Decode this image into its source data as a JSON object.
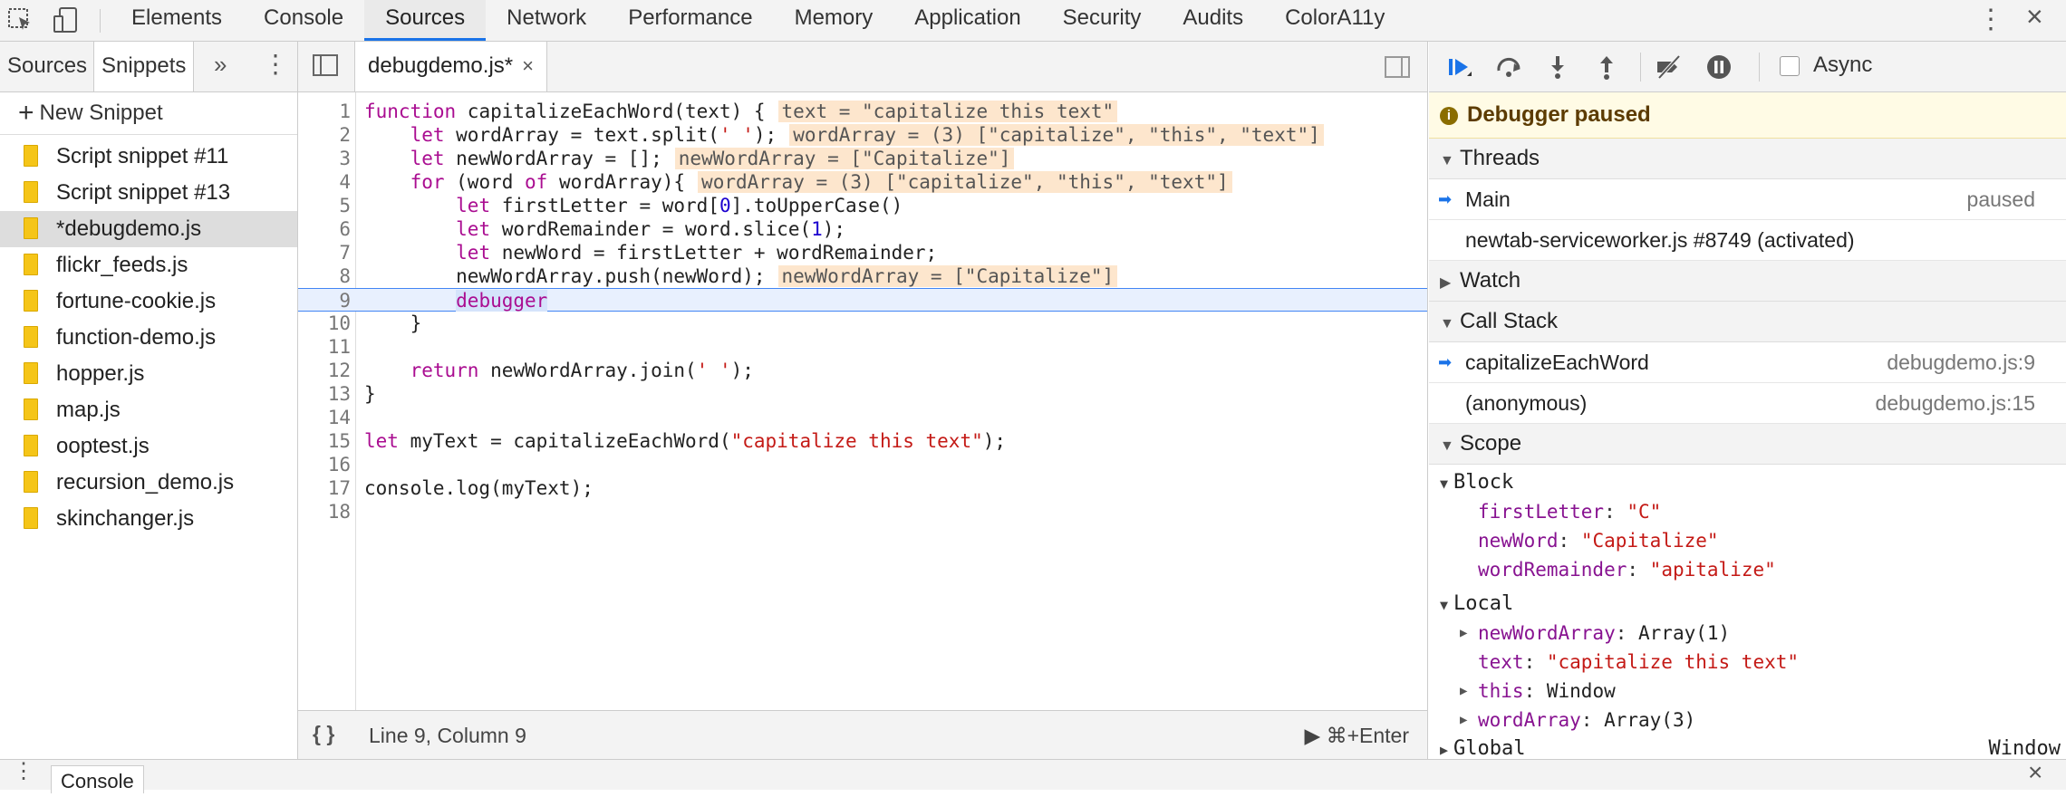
{
  "panel_tabs": [
    "Elements",
    "Console",
    "Sources",
    "Network",
    "Performance",
    "Memory",
    "Application",
    "Security",
    "Audits",
    "ColorA11y"
  ],
  "active_panel": "Sources",
  "navigator": {
    "tabs": [
      "Sources",
      "Snippets"
    ],
    "active_tab": "Snippets",
    "new_snippet": "New Snippet",
    "files": [
      "Script snippet #11",
      "Script snippet #13",
      "*debugdemo.js",
      "flickr_feeds.js",
      "fortune-cookie.js",
      "function-demo.js",
      "hopper.js",
      "map.js",
      "ooptest.js",
      "recursion_demo.js",
      "skinchanger.js"
    ],
    "selected_file": "*debugdemo.js"
  },
  "editor": {
    "tab_title": "debugdemo.js*",
    "line_numbers": [
      "1",
      "2",
      "3",
      "4",
      "5",
      "6",
      "7",
      "8",
      "9",
      "10",
      "11",
      "12",
      "13",
      "14",
      "15",
      "16",
      "17",
      "18"
    ],
    "inline_values": {
      "l1": "text = \"capitalize this text\"",
      "l2": "wordArray = (3) [\"capitalize\", \"this\", \"text\"]",
      "l3": "newWordArray = [\"Capitalize\"]",
      "l4": "wordArray = (3) [\"capitalize\", \"this\", \"text\"]",
      "l8": "newWordArray = [\"Capitalize\"]"
    },
    "status": "Line 9, Column 9",
    "run_label": "⌘+Enter"
  },
  "debugger": {
    "async_label": "Async",
    "paused_text": "Debugger paused",
    "threads_label": "Threads",
    "threads": [
      {
        "name": "Main",
        "status": "paused"
      },
      {
        "name": "newtab-serviceworker.js #8749 (activated)",
        "status": ""
      }
    ],
    "watch_label": "Watch",
    "callstack_label": "Call Stack",
    "callstack": [
      {
        "fn": "capitalizeEachWord",
        "loc": "debugdemo.js:9"
      },
      {
        "fn": "(anonymous)",
        "loc": "debugdemo.js:15"
      }
    ],
    "scope_label": "Scope",
    "block_label": "Block",
    "local_label": "Local",
    "global_label": "Global",
    "global_value": "Window"
  },
  "drawer": {
    "tab": "Console"
  }
}
